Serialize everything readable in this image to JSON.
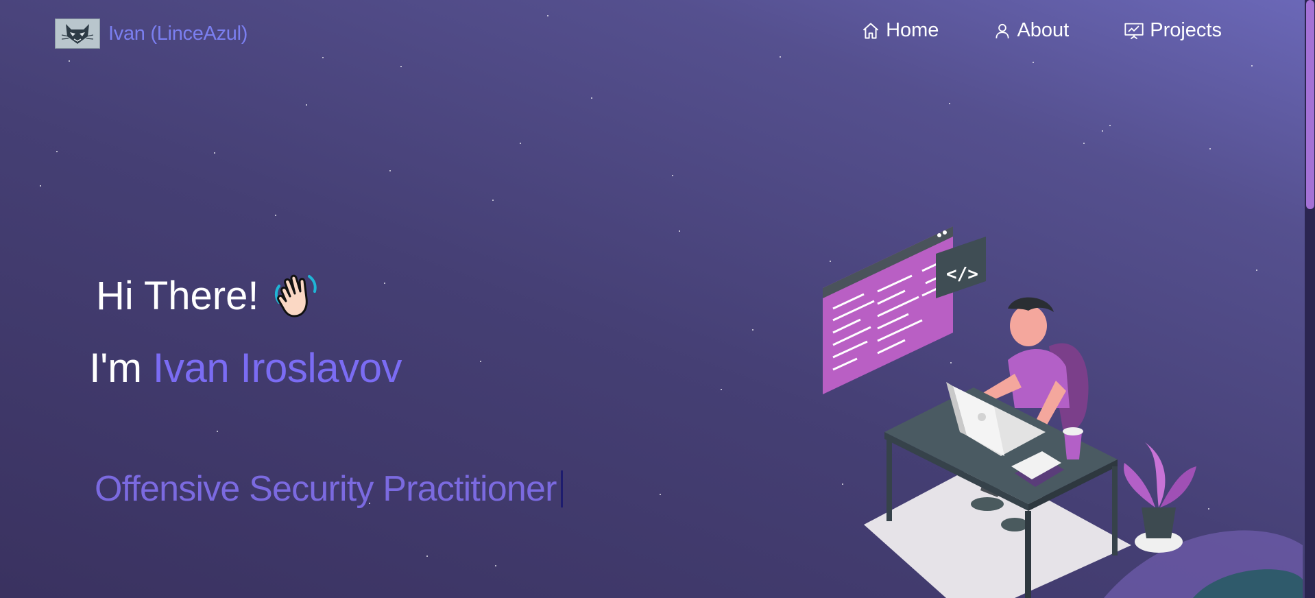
{
  "brand": {
    "name": "Ivan (LinceAzul)",
    "logo_icon": "lynx-logo-icon"
  },
  "nav": {
    "items": [
      {
        "label": "Home",
        "icon": "home-icon"
      },
      {
        "label": "About",
        "icon": "user-icon"
      },
      {
        "label": "Projects",
        "icon": "presentation-chart-icon"
      }
    ]
  },
  "hero": {
    "greeting": "Hi There!",
    "greeting_emoji": "waving-hand-icon",
    "intro_prefix": "I'm",
    "intro_name": "Ivan Iroslavov",
    "role": "Offensive Security Practitioner",
    "illustration": "developer-at-desk-illustration"
  },
  "colors": {
    "accent": "#7b6cf3",
    "brand_text": "#7b7ff0",
    "role_text": "#7b6ae0",
    "scroll_thumb": "#a471d6"
  }
}
